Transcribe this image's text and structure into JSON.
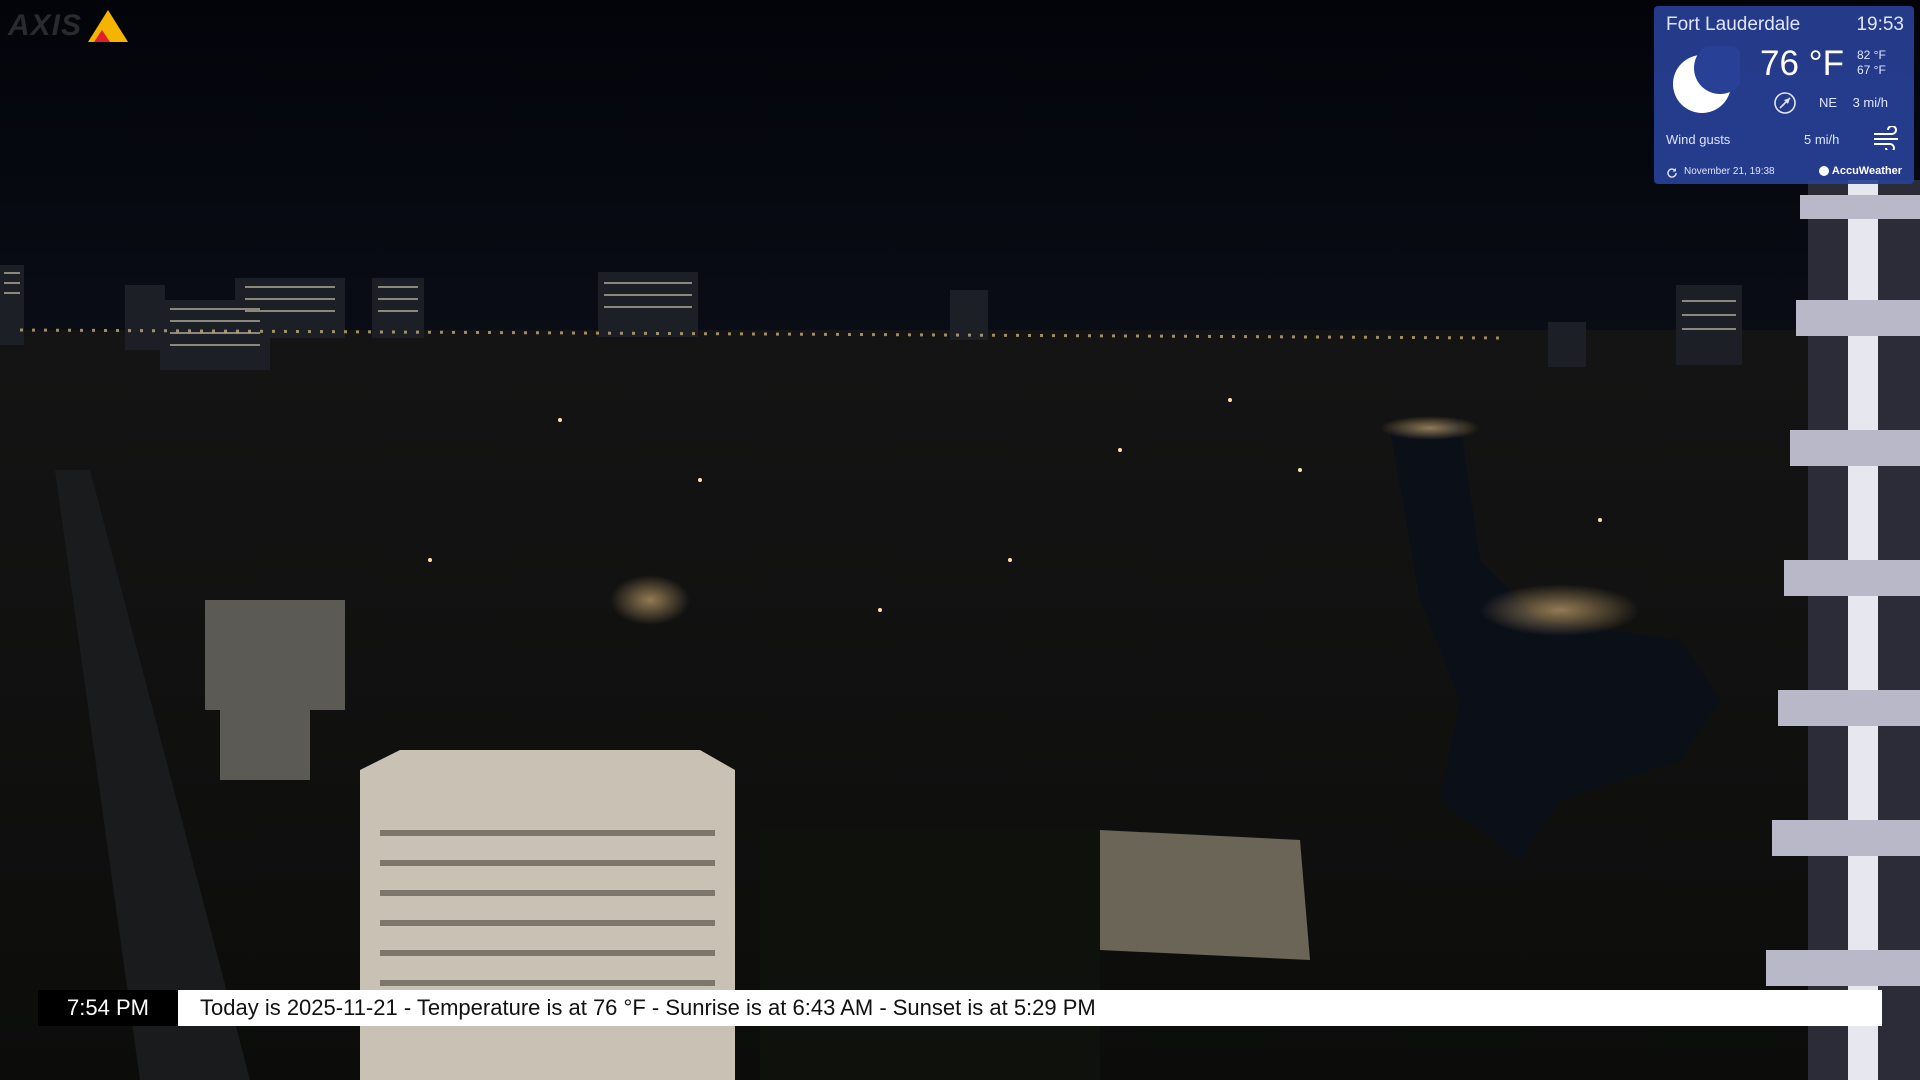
{
  "camera": {
    "logo_text": "AXIS",
    "logo_accent_colors": [
      "#f5b400",
      "#e0202a"
    ]
  },
  "weather": {
    "city": "Fort Lauderdale",
    "local_time": "19:53",
    "condition_icon": "crescent-moon-icon",
    "temperature": "76 °F",
    "high": "82 °F",
    "low": "67 °F",
    "wind_direction_icon": "compass-icon",
    "wind_direction": "NE",
    "wind_speed": "3 mi/h",
    "gusts_label": "Wind gusts",
    "gusts_value": "5 mi/h",
    "gusts_icon": "wind-icon",
    "updated": "November 21, 19:38",
    "provider": "AccuWeather",
    "panel_color": "#284096"
  },
  "ticker": {
    "time": "7:54 PM",
    "message": "Today is 2025-11-21 - Temperature is at  76 °F - Sunrise is at 6:43 AM - Sunset is at 5:29 PM"
  }
}
